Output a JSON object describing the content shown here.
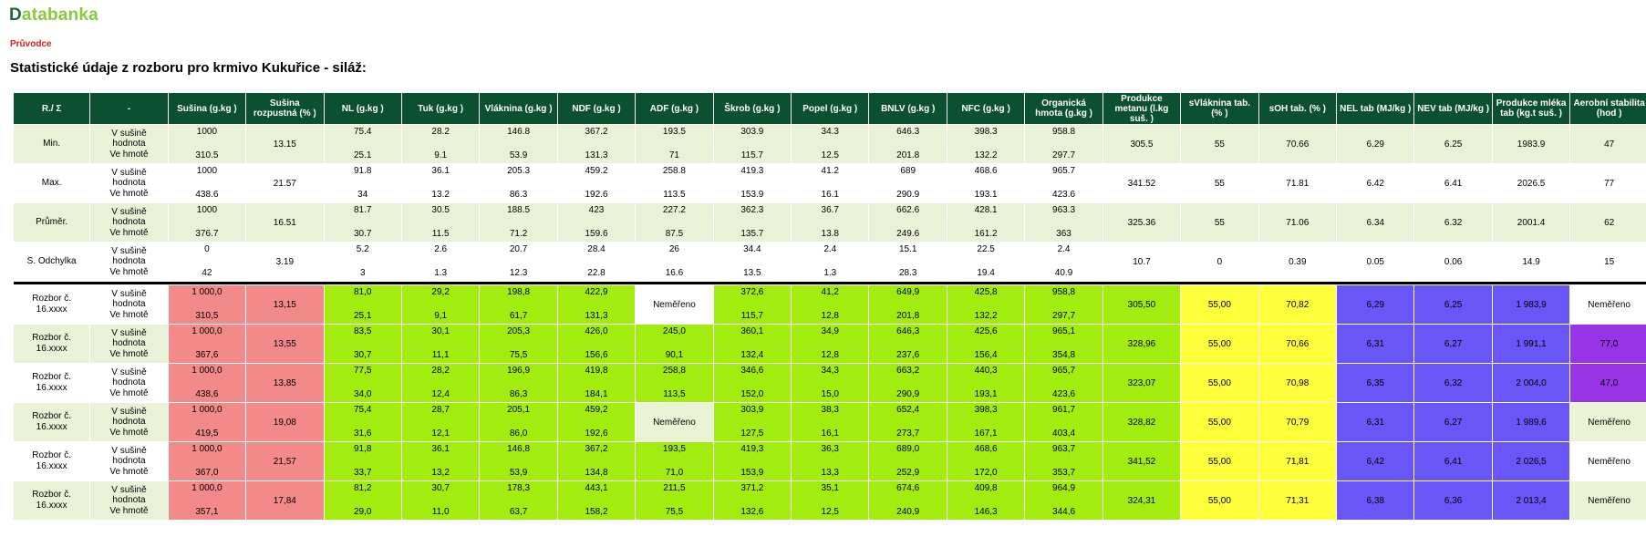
{
  "header": {
    "logo_first": "D",
    "logo_rest": "atabanka",
    "guide_link": "Průvodce",
    "page_title": "Statistické údaje z rozboru pro krmivo Kukuřice - siláž:"
  },
  "table": {
    "columns": [
      "R./ Σ",
      "-",
      "Sušina (g.kg )",
      "Sušina rozpustná (% )",
      "NL (g.kg )",
      "Tuk (g.kg )",
      "Vláknina (g.kg )",
      "NDF (g.kg )",
      "ADF (g.kg )",
      "Škrob (g.kg )",
      "Popel (g.kg )",
      "BNLV (g.kg )",
      "NFC (g.kg )",
      "Organická hmota (g.kg )",
      "Produkce metanu (l.kg suš. )",
      "sVláknina tab. (% )",
      "sOH tab. (% )",
      "NEL tab (MJ/kg )",
      "NEV tab (MJ/kg )",
      "Produkce mléka tab (kg.t suš. )",
      "Aerobní stabilita (hod )"
    ],
    "stat_rows": [
      {
        "label": "Min.",
        "sub_labels": [
          "V sušině",
          "hodnota",
          "Ve hmotě"
        ],
        "cells": [
          [
            "1000",
            "310.5"
          ],
          [
            "13.15"
          ],
          [
            "75.4",
            "25.1"
          ],
          [
            "28.2",
            "9.1"
          ],
          [
            "146.8",
            "53.9"
          ],
          [
            "367.2",
            "131.3"
          ],
          [
            "193.5",
            "71"
          ],
          [
            "303.9",
            "115.7"
          ],
          [
            "34.3",
            "12.5"
          ],
          [
            "646.3",
            "201.8"
          ],
          [
            "398.3",
            "132.2"
          ],
          [
            "958.8",
            "297.7"
          ],
          [
            "305.5"
          ],
          [
            "55"
          ],
          [
            "70.66"
          ],
          [
            "6.29"
          ],
          [
            "6.25"
          ],
          [
            "1983.9"
          ],
          [
            "47"
          ]
        ]
      },
      {
        "label": "Max.",
        "sub_labels": [
          "V sušině",
          "hodnota",
          "Ve hmotě"
        ],
        "cells": [
          [
            "1000",
            "438.6"
          ],
          [
            "21.57"
          ],
          [
            "91.8",
            "34"
          ],
          [
            "36.1",
            "13.2"
          ],
          [
            "205.3",
            "86.3"
          ],
          [
            "459.2",
            "192.6"
          ],
          [
            "258.8",
            "113.5"
          ],
          [
            "419.3",
            "153.9"
          ],
          [
            "41.2",
            "16.1"
          ],
          [
            "689",
            "290.9"
          ],
          [
            "468.6",
            "193.1"
          ],
          [
            "965.7",
            "423.6"
          ],
          [
            "341.52"
          ],
          [
            "55"
          ],
          [
            "71.81"
          ],
          [
            "6.42"
          ],
          [
            "6.41"
          ],
          [
            "2026.5"
          ],
          [
            "77"
          ]
        ]
      },
      {
        "label": "Průměr.",
        "sub_labels": [
          "V sušině",
          "hodnota",
          "Ve hmotě"
        ],
        "cells": [
          [
            "1000",
            "376.7"
          ],
          [
            "16.51"
          ],
          [
            "81.7",
            "30.7"
          ],
          [
            "30.5",
            "11.5"
          ],
          [
            "188.5",
            "71.2"
          ],
          [
            "423",
            "159.6"
          ],
          [
            "227.2",
            "87.5"
          ],
          [
            "362.3",
            "135.7"
          ],
          [
            "36.7",
            "13.8"
          ],
          [
            "662.6",
            "249.6"
          ],
          [
            "428.1",
            "161.2"
          ],
          [
            "963.3",
            "363"
          ],
          [
            "325.36"
          ],
          [
            "55"
          ],
          [
            "71.06"
          ],
          [
            "6.34"
          ],
          [
            "6.32"
          ],
          [
            "2001.4"
          ],
          [
            "62"
          ]
        ]
      },
      {
        "label": "S. Odchylka",
        "sub_labels": [
          "V sušině",
          "hodnota",
          "Ve hmotě"
        ],
        "cells": [
          [
            "0",
            "42"
          ],
          [
            "3.19"
          ],
          [
            "5.2",
            "3"
          ],
          [
            "2.6",
            "1.3"
          ],
          [
            "20.7",
            "12.3"
          ],
          [
            "28.4",
            "22.8"
          ],
          [
            "26",
            "16.6"
          ],
          [
            "34.4",
            "13.5"
          ],
          [
            "2.4",
            "1.3"
          ],
          [
            "15.1",
            "28.3"
          ],
          [
            "22.5",
            "19.4"
          ],
          [
            "2.4",
            "40.9"
          ],
          [
            "10.7"
          ],
          [
            "0"
          ],
          [
            "0.39"
          ],
          [
            "0.05"
          ],
          [
            "0.06"
          ],
          [
            "14.9"
          ],
          [
            "15"
          ]
        ]
      }
    ],
    "analysis_rows": [
      {
        "label_line1": "Rozbor č.",
        "label_line2": "16.xxxx",
        "sub_labels": [
          "V sušině",
          "hodnota",
          "Ve hmotě"
        ],
        "cells": [
          [
            "1 000,0",
            "310,5"
          ],
          [
            "13,15"
          ],
          [
            "81,0",
            "25,1"
          ],
          [
            "29,2",
            "9,1"
          ],
          [
            "198,8",
            "61,7"
          ],
          [
            "422,9",
            "131,3"
          ],
          [
            "Neměřeno"
          ],
          [
            "372,6",
            "115,7"
          ],
          [
            "41,2",
            "12,8"
          ],
          [
            "649,9",
            "201,8"
          ],
          [
            "425,8",
            "132,2"
          ],
          [
            "958,8",
            "297,7"
          ],
          [
            "305,50"
          ],
          [
            "55,00"
          ],
          [
            "70,82"
          ],
          [
            "6,29"
          ],
          [
            "6,25"
          ],
          [
            "1 983,9"
          ],
          [
            "Neměřeno"
          ]
        ],
        "colors": [
          "red",
          "red",
          "green",
          "green",
          "green",
          "green",
          "white",
          "green",
          "green",
          "green",
          "green",
          "green",
          "green",
          "yellow",
          "yellow",
          "blue",
          "blue",
          "blue",
          "white"
        ]
      },
      {
        "label_line1": "Rozbor č.",
        "label_line2": "16.xxxx",
        "sub_labels": [
          "V sušině",
          "hodnota",
          "Ve hmotě"
        ],
        "cells": [
          [
            "1 000,0",
            "367,6"
          ],
          [
            "13,55"
          ],
          [
            "83,5",
            "30,7"
          ],
          [
            "30,1",
            "11,1"
          ],
          [
            "205,3",
            "75,5"
          ],
          [
            "426,0",
            "156,6"
          ],
          [
            "245,0",
            "90,1"
          ],
          [
            "360,1",
            "132,4"
          ],
          [
            "34,9",
            "12,8"
          ],
          [
            "646,3",
            "237,6"
          ],
          [
            "425,6",
            "156,4"
          ],
          [
            "965,1",
            "354,8"
          ],
          [
            "328,96"
          ],
          [
            "55,00"
          ],
          [
            "70,66"
          ],
          [
            "6,31"
          ],
          [
            "6,27"
          ],
          [
            "1 991,1"
          ],
          [
            "77,0"
          ]
        ],
        "colors": [
          "red",
          "red",
          "green",
          "green",
          "green",
          "green",
          "green",
          "green",
          "green",
          "green",
          "green",
          "green",
          "green",
          "yellow",
          "yellow",
          "blue",
          "blue",
          "blue",
          "purple"
        ]
      },
      {
        "label_line1": "Rozbor č.",
        "label_line2": "16.xxxx",
        "sub_labels": [
          "V sušině",
          "hodnota",
          "Ve hmotě"
        ],
        "cells": [
          [
            "1 000,0",
            "438,6"
          ],
          [
            "13,85"
          ],
          [
            "77,5",
            "34,0"
          ],
          [
            "28,2",
            "12,4"
          ],
          [
            "196,9",
            "86,3"
          ],
          [
            "419,8",
            "184,1"
          ],
          [
            "258,8",
            "113,5"
          ],
          [
            "346,6",
            "152,0"
          ],
          [
            "34,3",
            "15,0"
          ],
          [
            "663,2",
            "290,9"
          ],
          [
            "440,3",
            "193,1"
          ],
          [
            "965,7",
            "423,6"
          ],
          [
            "323,07"
          ],
          [
            "55,00"
          ],
          [
            "70,98"
          ],
          [
            "6,35"
          ],
          [
            "6,32"
          ],
          [
            "2 004,0"
          ],
          [
            "47,0"
          ]
        ],
        "colors": [
          "red",
          "red",
          "green",
          "green",
          "green",
          "green",
          "green",
          "green",
          "green",
          "green",
          "green",
          "green",
          "green",
          "yellow",
          "yellow",
          "blue",
          "blue",
          "blue",
          "purple"
        ]
      },
      {
        "label_line1": "Rozbor č.",
        "label_line2": "16.xxxx",
        "sub_labels": [
          "V sušině",
          "hodnota",
          "Ve hmotě"
        ],
        "cells": [
          [
            "1 000,0",
            "419,5"
          ],
          [
            "19,08"
          ],
          [
            "75,4",
            "31,6"
          ],
          [
            "28,7",
            "12,1"
          ],
          [
            "205,1",
            "86,0"
          ],
          [
            "459,2",
            "192,6"
          ],
          [
            "Neměřeno"
          ],
          [
            "303,9",
            "127,5"
          ],
          [
            "38,3",
            "16,1"
          ],
          [
            "652,4",
            "273,7"
          ],
          [
            "398,3",
            "167,1"
          ],
          [
            "961,7",
            "403,4"
          ],
          [
            "328,82"
          ],
          [
            "55,00"
          ],
          [
            "70,79"
          ],
          [
            "6,31"
          ],
          [
            "6,27"
          ],
          [
            "1 989,6"
          ],
          [
            "Neměřeno"
          ]
        ],
        "colors": [
          "red",
          "red",
          "green",
          "green",
          "green",
          "green",
          "pale",
          "green",
          "green",
          "green",
          "green",
          "green",
          "green",
          "yellow",
          "yellow",
          "blue",
          "blue",
          "blue",
          "pale"
        ]
      },
      {
        "label_line1": "Rozbor č.",
        "label_line2": "16.xxxx",
        "sub_labels": [
          "V sušině",
          "hodnota",
          "Ve hmotě"
        ],
        "cells": [
          [
            "1 000,0",
            "367,0"
          ],
          [
            "21,57"
          ],
          [
            "91,8",
            "33,7"
          ],
          [
            "36,1",
            "13,2"
          ],
          [
            "146,8",
            "53,9"
          ],
          [
            "367,2",
            "134,8"
          ],
          [
            "193,5",
            "71,0"
          ],
          [
            "419,3",
            "153,9"
          ],
          [
            "36,3",
            "13,3"
          ],
          [
            "689,0",
            "252,9"
          ],
          [
            "468,6",
            "172,0"
          ],
          [
            "963,7",
            "353,7"
          ],
          [
            "341,52"
          ],
          [
            "55,00"
          ],
          [
            "71,81"
          ],
          [
            "6,42"
          ],
          [
            "6,41"
          ],
          [
            "2 026,5"
          ],
          [
            "Neměřeno"
          ]
        ],
        "colors": [
          "red",
          "red",
          "green",
          "green",
          "green",
          "green",
          "green",
          "green",
          "green",
          "green",
          "green",
          "green",
          "green",
          "yellow",
          "yellow",
          "blue",
          "blue",
          "blue",
          "white"
        ]
      },
      {
        "label_line1": "Rozbor č.",
        "label_line2": "16.xxxx",
        "sub_labels": [
          "V sušině",
          "hodnota",
          "Ve hmotě"
        ],
        "cells": [
          [
            "1 000,0",
            "357,1"
          ],
          [
            "17,84"
          ],
          [
            "81,2",
            "29,0"
          ],
          [
            "30,7",
            "11,0"
          ],
          [
            "178,3",
            "63,7"
          ],
          [
            "443,1",
            "158,2"
          ],
          [
            "211,5",
            "75,5"
          ],
          [
            "371,2",
            "132,6"
          ],
          [
            "35,1",
            "12,5"
          ],
          [
            "674,6",
            "240,9"
          ],
          [
            "409,8",
            "146,3"
          ],
          [
            "964,9",
            "344,6"
          ],
          [
            "324,31"
          ],
          [
            "55,00"
          ],
          [
            "71,31"
          ],
          [
            "6,38"
          ],
          [
            "6,36"
          ],
          [
            "2 013,4"
          ],
          [
            "Neměřeno"
          ]
        ],
        "colors": [
          "red",
          "red",
          "green",
          "green",
          "green",
          "green",
          "green",
          "green",
          "green",
          "green",
          "green",
          "green",
          "green",
          "yellow",
          "yellow",
          "blue",
          "blue",
          "blue",
          "pale"
        ]
      }
    ]
  }
}
